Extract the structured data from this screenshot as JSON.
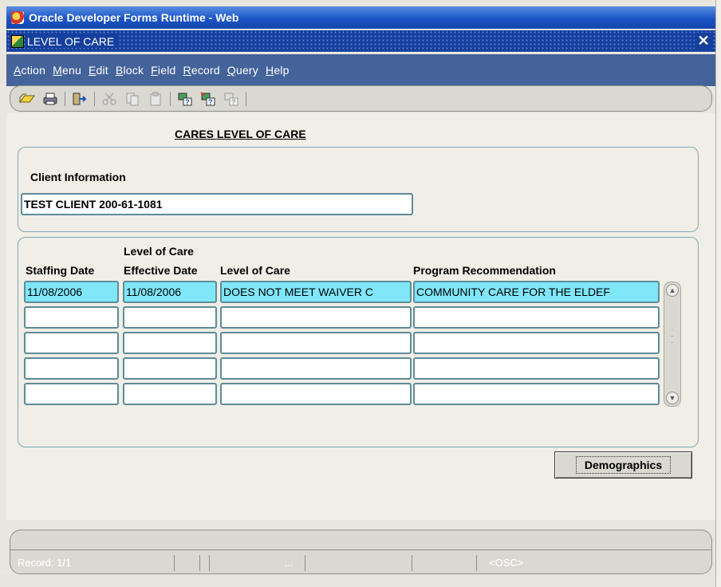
{
  "browser": {
    "title": "Oracle Developer Forms Runtime - Web"
  },
  "window": {
    "title": "LEVEL OF CARE",
    "close_label": "✕"
  },
  "menu": [
    {
      "label": "Action",
      "accel": "A",
      "rest": "ction"
    },
    {
      "label": "Menu",
      "accel": "M",
      "rest": "enu"
    },
    {
      "label": "Edit",
      "accel": "E",
      "rest": "dit"
    },
    {
      "label": "Block",
      "accel": "B",
      "rest": "lock"
    },
    {
      "label": "Field",
      "accel": "F",
      "rest": "ield"
    },
    {
      "label": "Record",
      "accel": "R",
      "rest": "ecord"
    },
    {
      "label": "Query",
      "accel": "Q",
      "rest": "uery"
    },
    {
      "label": "Help",
      "accel": "H",
      "rest": "elp"
    }
  ],
  "toolbar": {
    "icons": [
      "save-icon",
      "print-icon",
      "exit-icon",
      "cut-icon",
      "copy-icon",
      "paste-icon",
      "enter-query-icon",
      "execute-query-icon",
      "cancel-query-icon"
    ]
  },
  "form": {
    "heading": "CARES LEVEL OF CARE",
    "client_section_label": "Client Information",
    "client_value": "TEST CLIENT  200-61-1081",
    "columns": {
      "staffing_date": "Staffing Date",
      "effective_date_top": "Level of Care",
      "effective_date": "Effective Date",
      "level_of_care": "Level of Care",
      "program_recommendation": "Program Recommendation"
    },
    "rows": [
      {
        "staffing_date": "11/08/2006",
        "effective_date": "11/08/2006",
        "level_of_care": "DOES NOT MEET WAIVER C",
        "program_recommendation": "COMMUNITY CARE FOR THE ELDEF"
      },
      {
        "staffing_date": "",
        "effective_date": "",
        "level_of_care": "",
        "program_recommendation": ""
      },
      {
        "staffing_date": "",
        "effective_date": "",
        "level_of_care": "",
        "program_recommendation": ""
      },
      {
        "staffing_date": "",
        "effective_date": "",
        "level_of_care": "",
        "program_recommendation": ""
      },
      {
        "staffing_date": "",
        "effective_date": "",
        "level_of_care": "",
        "program_recommendation": ""
      }
    ],
    "demographics_button": "Demographics"
  },
  "status": {
    "record": "Record: 1/1",
    "ellipsis": "...",
    "osc": "<OSC>"
  },
  "colors": {
    "title_bar": "#1a55c6",
    "menu_bar": "#44639a",
    "active_row": "#7fe7f8",
    "field_border": "#5e8c98"
  }
}
